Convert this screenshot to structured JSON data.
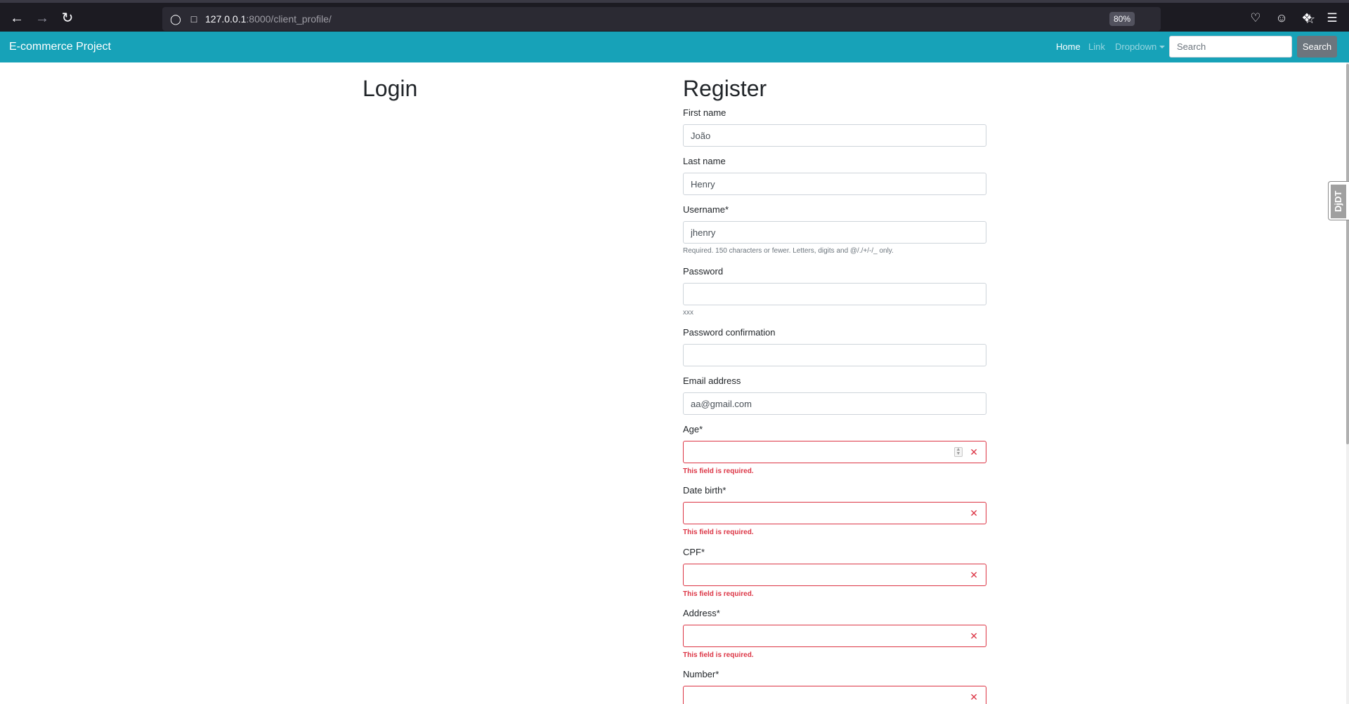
{
  "browser": {
    "url_host": "127.0.0.1",
    "url_path": ":8000/client_profile/",
    "zoom": "80%"
  },
  "navbar": {
    "brand": "E-commerce Project",
    "links": {
      "home": "Home",
      "link": "Link",
      "dropdown": "Dropdown"
    },
    "search_placeholder": "Search",
    "search_button": "Search",
    "bg_color": "#17a2b8"
  },
  "login": {
    "title": "Login"
  },
  "register": {
    "title": "Register",
    "fields": {
      "first_name": {
        "label": "First name",
        "value": "João"
      },
      "last_name": {
        "label": "Last name",
        "value": "Henry"
      },
      "username": {
        "label": "Username*",
        "value": "jhenry",
        "help": "Required. 150 characters or fewer. Letters, digits and @/./+/-/_ only."
      },
      "password": {
        "label": "Password",
        "value": "",
        "help": "xxx"
      },
      "password_confirmation": {
        "label": "Password confirmation",
        "value": ""
      },
      "email": {
        "label": "Email address",
        "value": "aa@gmail.com"
      },
      "age": {
        "label": "Age*",
        "value": "",
        "error": "This field is required."
      },
      "date_birth": {
        "label": "Date birth*",
        "value": "",
        "error": "This field is required."
      },
      "cpf": {
        "label": "CPF*",
        "value": "",
        "error": "This field is required."
      },
      "address": {
        "label": "Address*",
        "value": "",
        "error": "This field is required."
      },
      "number": {
        "label": "Number*",
        "value": ""
      }
    },
    "error_color": "#dc3545"
  },
  "debug_toolbar": {
    "label": "DjDT"
  }
}
